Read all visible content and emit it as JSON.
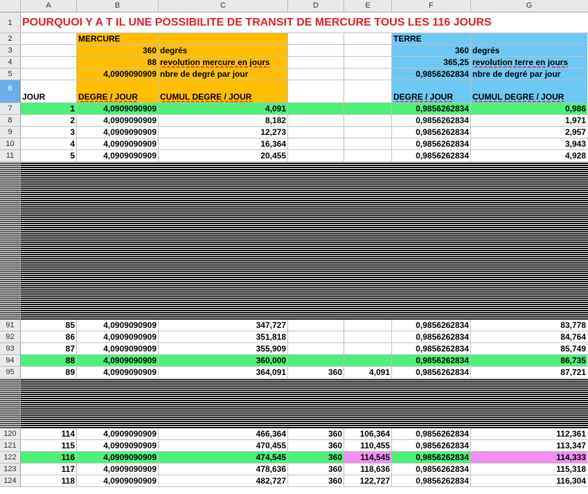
{
  "columns": [
    "A",
    "B",
    "C",
    "D",
    "E",
    "F",
    "G"
  ],
  "title": "POURQUOI Y A T IL UNE POSSIBILITE DE TRANSIT DE MERCURE TOUS LES 116 JOURS",
  "mercure": {
    "label": "MERCURE",
    "degrees": "360",
    "degrees_label": "degrés",
    "revolution": "88",
    "revolution_label": "revolution mercure en jours",
    "per_day": "4,0909090909",
    "per_day_label": "nbre de degré par jour"
  },
  "terre": {
    "label": "TERRE",
    "degrees": "360",
    "degrees_label": "degrés",
    "revolution": "365,25",
    "revolution_label": "revolution terre en jours",
    "per_day": "0,9856262834",
    "per_day_label": "nbre de degré par jour"
  },
  "headers": {
    "jour": "JOUR",
    "degre_jour": "DEGRE / JOUR",
    "cumul": "CUMUL DEGRE / JOUR",
    "terre_degre_jour": "DEGRE / JOUR",
    "terre_cumul": "CUMUL DEGRE / JOUR"
  },
  "row_numbers": [
    "1",
    "2",
    "3",
    "4",
    "5",
    "6"
  ],
  "rows_top": [
    {
      "rn": "7",
      "jour": "1",
      "deg": "4,0909090909",
      "cumul": "4,091",
      "d": "",
      "e": "",
      "f": "0,9856262834",
      "g": "0,986",
      "hl": "green"
    },
    {
      "rn": "8",
      "jour": "2",
      "deg": "4,0909090909",
      "cumul": "8,182",
      "d": "",
      "e": "",
      "f": "0,9856262834",
      "g": "1,971",
      "hl": ""
    },
    {
      "rn": "9",
      "jour": "3",
      "deg": "4,0909090909",
      "cumul": "12,273",
      "d": "",
      "e": "",
      "f": "0,9856262834",
      "g": "2,957",
      "hl": ""
    },
    {
      "rn": "10",
      "jour": "4",
      "deg": "4,0909090909",
      "cumul": "16,364",
      "d": "",
      "e": "",
      "f": "0,9856262834",
      "g": "3,943",
      "hl": ""
    },
    {
      "rn": "11",
      "jour": "5",
      "deg": "4,0909090909",
      "cumul": "20,455",
      "d": "",
      "e": "",
      "f": "0,9856262834",
      "g": "4,928",
      "hl": ""
    }
  ],
  "rows_mid": [
    {
      "rn": "91",
      "jour": "85",
      "deg": "4,0909090909",
      "cumul": "347,727",
      "d": "",
      "e": "",
      "f": "0,9856262834",
      "g": "83,778",
      "hl": ""
    },
    {
      "rn": "92",
      "jour": "86",
      "deg": "4,0909090909",
      "cumul": "351,818",
      "d": "",
      "e": "",
      "f": "0,9856262834",
      "g": "84,764",
      "hl": ""
    },
    {
      "rn": "93",
      "jour": "87",
      "deg": "4,0909090909",
      "cumul": "355,909",
      "d": "",
      "e": "",
      "f": "0,9856262834",
      "g": "85,749",
      "hl": ""
    },
    {
      "rn": "94",
      "jour": "88",
      "deg": "4,0909090909",
      "cumul": "360,000",
      "d": "",
      "e": "",
      "f": "0,9856262834",
      "g": "86,735",
      "hl": "green"
    },
    {
      "rn": "95",
      "jour": "89",
      "deg": "4,0909090909",
      "cumul": "364,091",
      "d": "360",
      "e": "4,091",
      "f": "0,9856262834",
      "g": "87,721",
      "hl": ""
    }
  ],
  "rows_bottom": [
    {
      "rn": "120",
      "jour": "114",
      "deg": "4,0909090909",
      "cumul": "466,364",
      "d": "360",
      "e": "106,364",
      "f": "0,9856262834",
      "g": "112,361",
      "hl": ""
    },
    {
      "rn": "121",
      "jour": "115",
      "deg": "4,0909090909",
      "cumul": "470,455",
      "d": "360",
      "e": "110,455",
      "f": "0,9856262834",
      "g": "113,347",
      "hl": ""
    },
    {
      "rn": "122",
      "jour": "116",
      "deg": "4,0909090909",
      "cumul": "474,545",
      "d": "360",
      "e": "114,545",
      "f": "0,9856262834",
      "g": "114,333",
      "hl": "green-pink"
    },
    {
      "rn": "123",
      "jour": "117",
      "deg": "4,0909090909",
      "cumul": "478,636",
      "d": "360",
      "e": "118,636",
      "f": "0,9856262834",
      "g": "115,318",
      "hl": ""
    },
    {
      "rn": "124",
      "jour": "118",
      "deg": "4,0909090909",
      "cumul": "482,727",
      "d": "360",
      "e": "122,727",
      "f": "0,9856262834",
      "g": "116,304",
      "hl": ""
    }
  ],
  "colors": {
    "orange": "#ffbf00",
    "blue": "#6dc8f5",
    "green": "#4ef07a",
    "pink": "#f48ef0",
    "title": "#e02020"
  }
}
